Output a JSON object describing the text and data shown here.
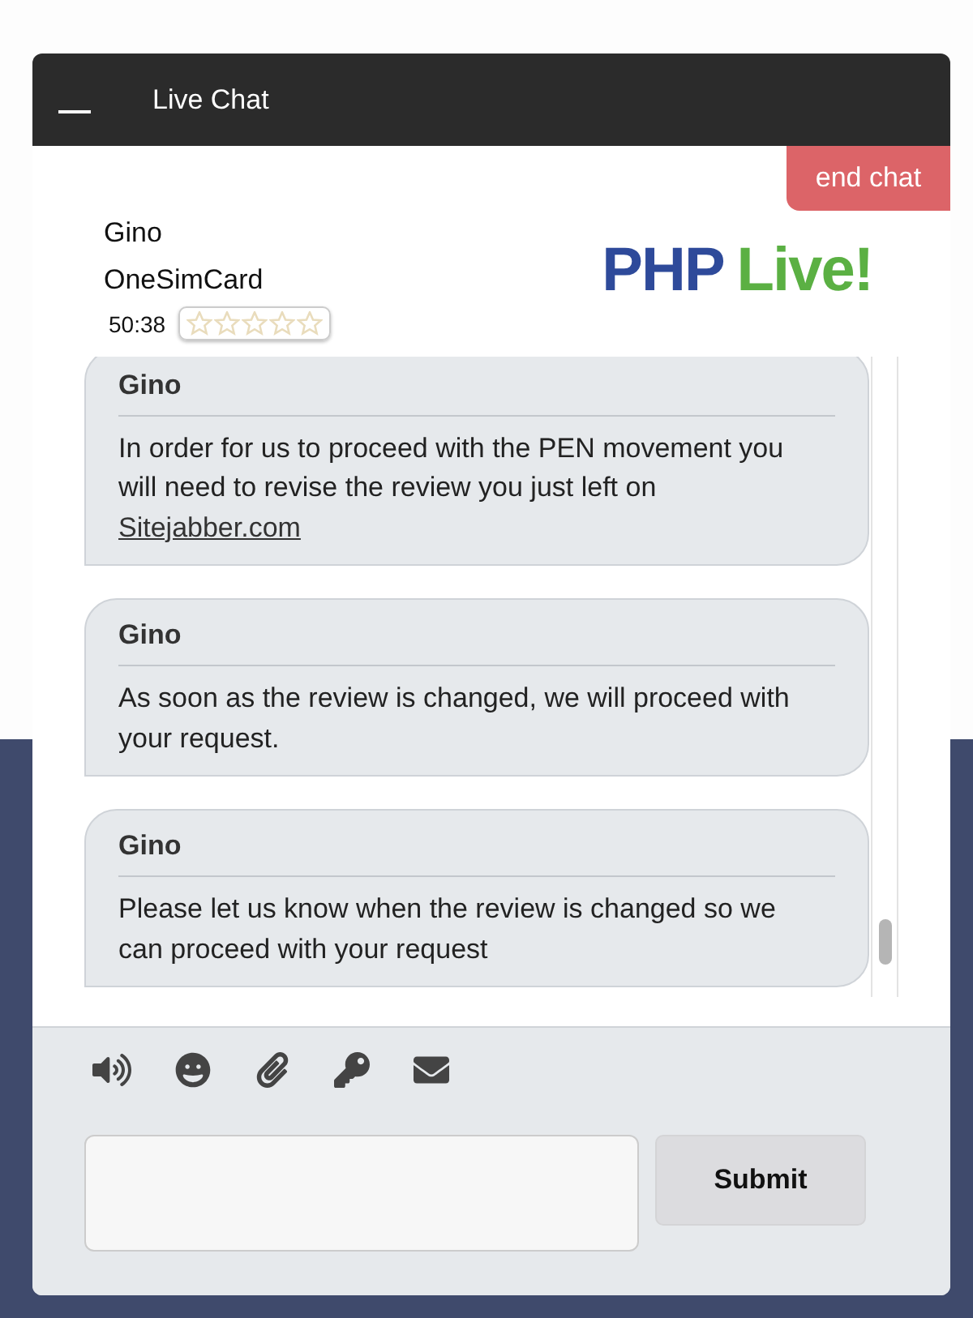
{
  "window": {
    "title": "Live Chat"
  },
  "end_chat": "end chat",
  "operator": {
    "name": "Gino",
    "company": "OneSimCard",
    "timer": "50:38",
    "stars": 0
  },
  "logo": {
    "part_1": "PHP",
    "part_2": "Live!"
  },
  "messages": [
    {
      "author": "Gino",
      "text": "In order for us to proceed with the PEN movement you will need to revise the review you just left on",
      "link": "Sitejabber.com"
    },
    {
      "author": "Gino",
      "text": "As soon as the review is changed, we will proceed with your request."
    },
    {
      "author": "Gino",
      "text": "Please let us know when the review is changed so we can proceed with your request"
    }
  ],
  "toolbar": [
    {
      "kind": "sound"
    },
    {
      "kind": "emoji"
    },
    {
      "kind": "attach"
    },
    {
      "kind": "key"
    },
    {
      "kind": "email"
    }
  ],
  "submit": "Submit"
}
